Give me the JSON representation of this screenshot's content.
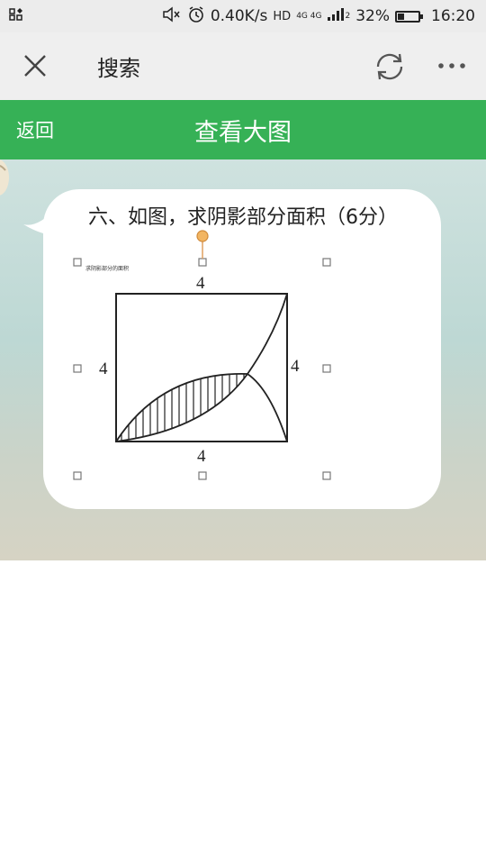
{
  "status_bar": {
    "speed": "0.40K/s",
    "hd": "HD",
    "network": "4G 4G",
    "sim_index": "2",
    "battery_percent_text": "32%",
    "battery_level": 0.32,
    "time": "16:20",
    "icons": [
      "notification-icon",
      "mute-icon",
      "alarm-icon",
      "signal-icon",
      "battery-icon"
    ]
  },
  "nav": {
    "title": "搜索",
    "icons": [
      "close-icon",
      "refresh-icon",
      "more-icon"
    ]
  },
  "viewer": {
    "back_label": "返回",
    "title": "查看大图"
  },
  "problem": {
    "text": "六、如图，求阴影部分面积（6分）",
    "figure_caption": "求阴影部分的面积",
    "labels": {
      "top": "4",
      "left": "4",
      "right": "4",
      "bottom": "4"
    }
  }
}
